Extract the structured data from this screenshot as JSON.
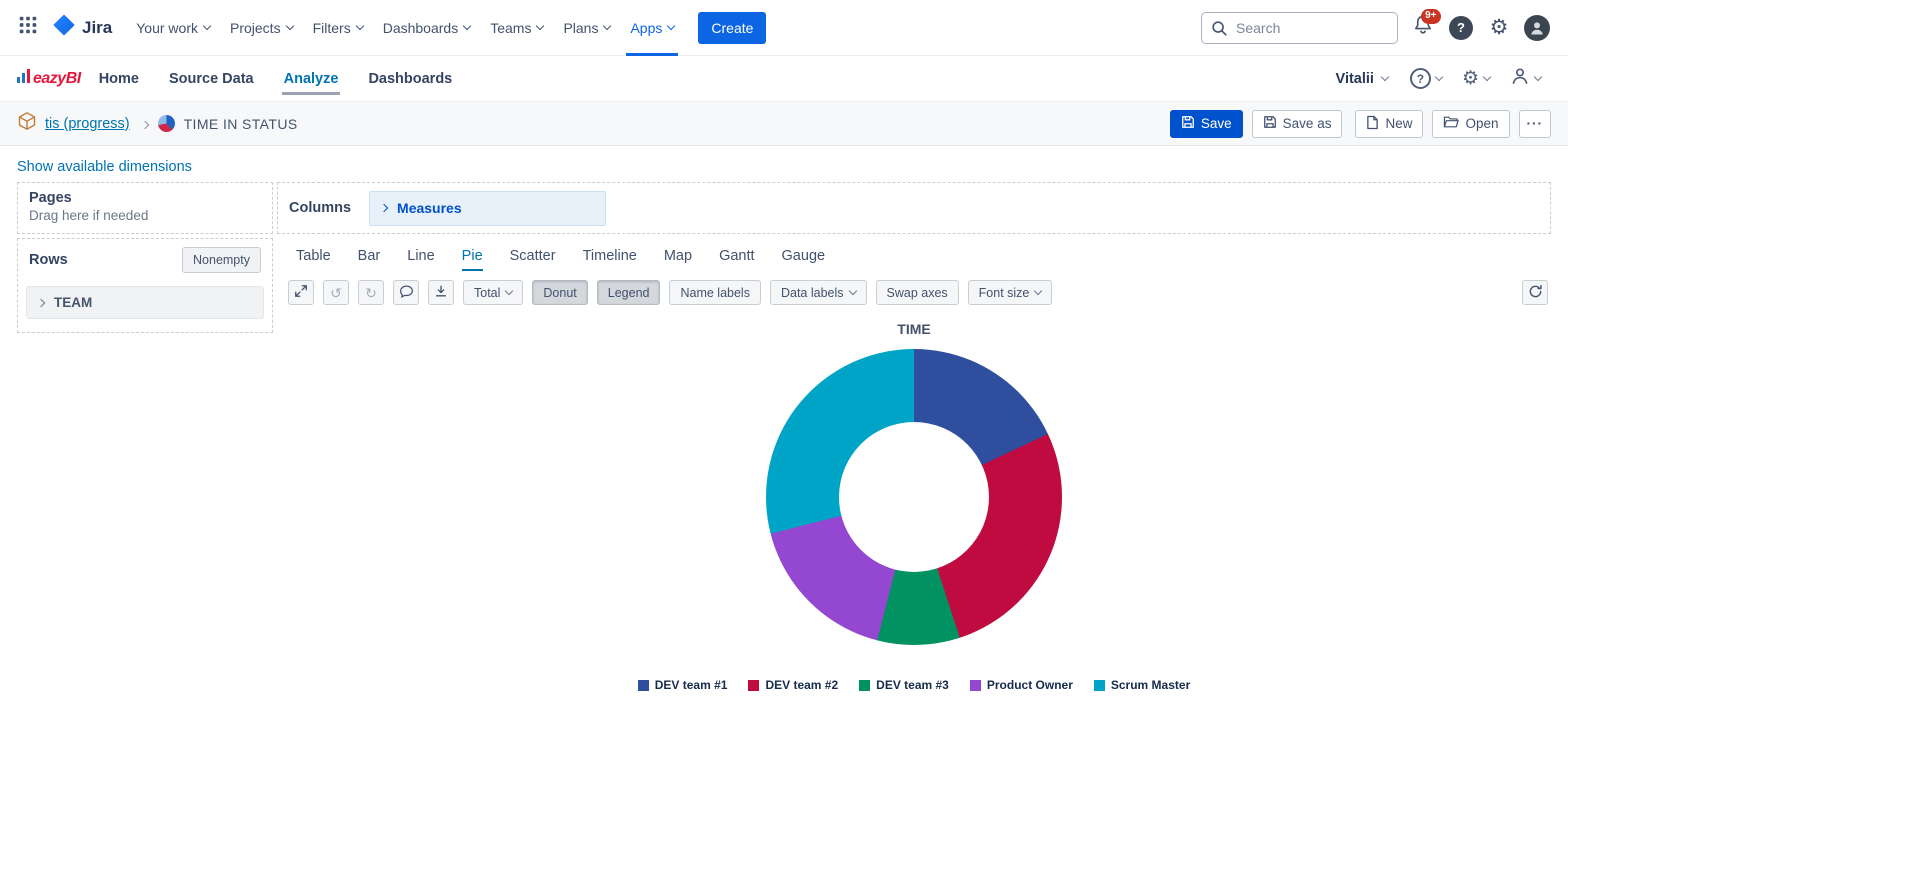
{
  "jira_nav": {
    "logo_text": "Jira",
    "items": [
      {
        "label": "Your work"
      },
      {
        "label": "Projects"
      },
      {
        "label": "Filters"
      },
      {
        "label": "Dashboards"
      },
      {
        "label": "Teams"
      },
      {
        "label": "Plans"
      },
      {
        "label": "Apps"
      }
    ],
    "create_label": "Create",
    "search_placeholder": "Search",
    "notifications_badge": "9+"
  },
  "eazybi_nav": {
    "logo_text": "eazyBI",
    "items": [
      {
        "label": "Home"
      },
      {
        "label": "Source Data"
      },
      {
        "label": "Analyze"
      },
      {
        "label": "Dashboards"
      }
    ],
    "user_name": "Vitalii"
  },
  "report_header": {
    "account": "tis (progress)",
    "title": "TIME IN STATUS",
    "save_label": "Save",
    "save_as_label": "Save as",
    "new_label": "New",
    "open_label": "Open",
    "more_label": "···"
  },
  "dimensions_link": "Show available dimensions",
  "layout_panel": {
    "pages_label": "Pages",
    "pages_hint": "Drag here if needed",
    "rows_label": "Rows",
    "nonempty_label": "Nonempty",
    "row_item": "TEAM",
    "columns_label": "Columns",
    "column_item": "Measures"
  },
  "chart_tabs": [
    {
      "label": "Table"
    },
    {
      "label": "Bar"
    },
    {
      "label": "Line"
    },
    {
      "label": "Pie"
    },
    {
      "label": "Scatter"
    },
    {
      "label": "Timeline"
    },
    {
      "label": "Map"
    },
    {
      "label": "Gantt"
    },
    {
      "label": "Gauge"
    }
  ],
  "toolbar": {
    "total_label": "Total",
    "donut_label": "Donut",
    "legend_label": "Legend",
    "name_labels_label": "Name labels",
    "data_labels_label": "Data labels",
    "swap_axes_label": "Swap axes",
    "font_size_label": "Font size"
  },
  "icons": {
    "help_glyph": "?",
    "gear_glyph": "⚙",
    "undo_glyph": "↺",
    "redo_glyph": "↻"
  },
  "chart_data": {
    "type": "pie",
    "variant": "donut",
    "title": "TIME",
    "legend_position": "bottom",
    "categories": [
      "DEV team #1",
      "DEV team #2",
      "DEV team #3",
      "Product Owner",
      "Scrum Master"
    ],
    "values": [
      18,
      27,
      9,
      17,
      29
    ],
    "colors": [
      "#2f4e9d",
      "#c00b41",
      "#009261",
      "#9448d2",
      "#00a4c6"
    ]
  }
}
